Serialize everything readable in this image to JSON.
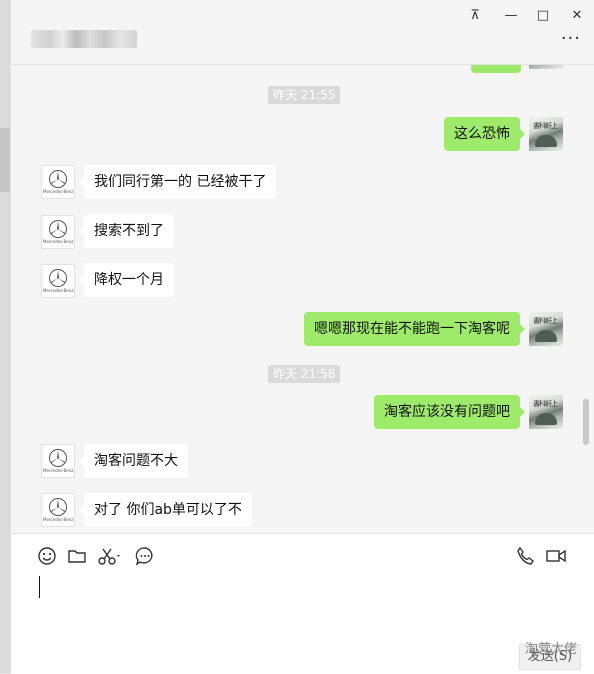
{
  "window": {
    "contact_name": "",
    "buttons": {
      "pin_label": "⊼",
      "minimize_label": "—",
      "maximize_label": "□",
      "close_label": "✕",
      "more_label": "···"
    }
  },
  "chat": {
    "timestamps": [
      "昨天 21:55",
      "昨天 21:58"
    ],
    "messages": [
      {
        "side": "out",
        "text": "这么恐怖"
      },
      {
        "side": "in",
        "text": "我们同行第一的 已经被干了"
      },
      {
        "side": "in",
        "text": "搜索不到了"
      },
      {
        "side": "in",
        "text": "降权一个月"
      },
      {
        "side": "out",
        "text": "嗯嗯那现在能不能跑一下淘客呢"
      },
      {
        "side": "out",
        "text": "淘客应该没有问题吧"
      },
      {
        "side": "in",
        "text": "淘客问题不大"
      },
      {
        "side": "in",
        "text": "对了 你们ab单可以了不"
      }
    ],
    "avatars": {
      "contact_logo_text": "Mercedes-Benz",
      "self_avatar_text": "書科軒上"
    }
  },
  "composer": {
    "toolbar": [
      "emoji-icon",
      "folder-icon",
      "scissors-icon",
      "chat-bubble-icon",
      "phone-icon",
      "video-icon"
    ],
    "send_label": "发送(S)",
    "watermark": "淘营大佬"
  },
  "colors": {
    "sent_bubble": "#9eea6a",
    "received_bubble": "#ffffff",
    "background": "#f5f5f5"
  }
}
